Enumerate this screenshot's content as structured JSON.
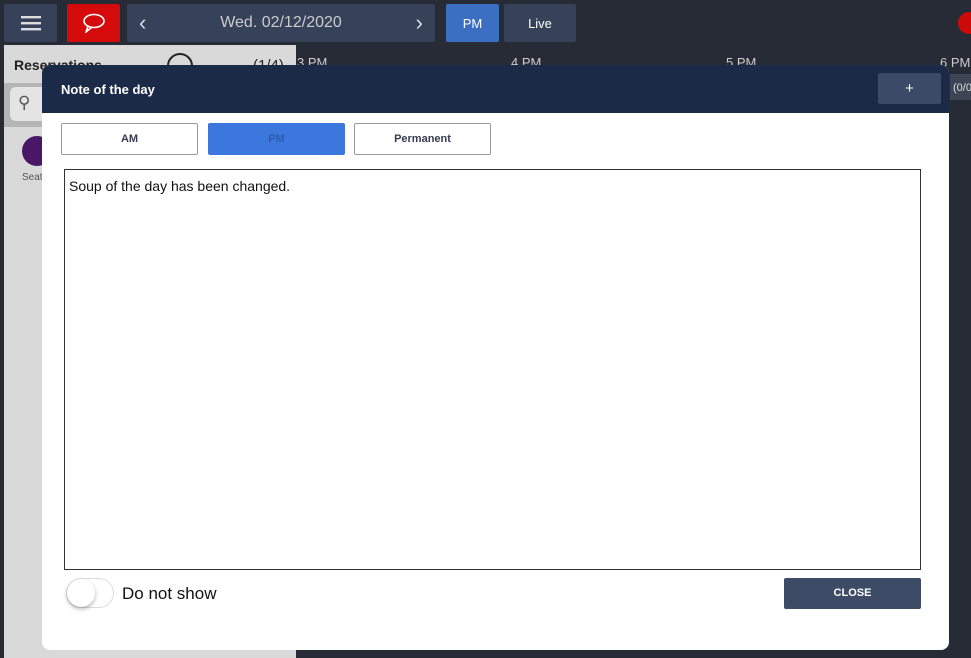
{
  "topbar": {
    "date": "Wed. 02/12/2020",
    "pm_label": "PM",
    "live_label": "Live",
    "icons": [
      "menu-icon",
      "chat-icon",
      "chevron-left-icon",
      "chevron-right-icon"
    ]
  },
  "left_panel": {
    "title": "Reservations",
    "count": "(1/4)",
    "seat_label": "Seat"
  },
  "timeline": {
    "labels": [
      "3 PM",
      "4 PM",
      "5 PM",
      "6 PM"
    ],
    "side_count": "(0/0"
  },
  "modal": {
    "title": "Note of the day",
    "add_label": "+",
    "tabs": [
      {
        "label": "AM",
        "active": false
      },
      {
        "label": "PM",
        "active": true
      },
      {
        "label": "Permanent",
        "active": false
      }
    ],
    "note": "Soup of the day has been changed.",
    "toggle_label": "Do not show",
    "toggle_on": false,
    "close_label": "CLOSE"
  },
  "colors": {
    "accent": "#3b73d8",
    "header": "#1b2a46",
    "alert": "#cc0a0a"
  }
}
